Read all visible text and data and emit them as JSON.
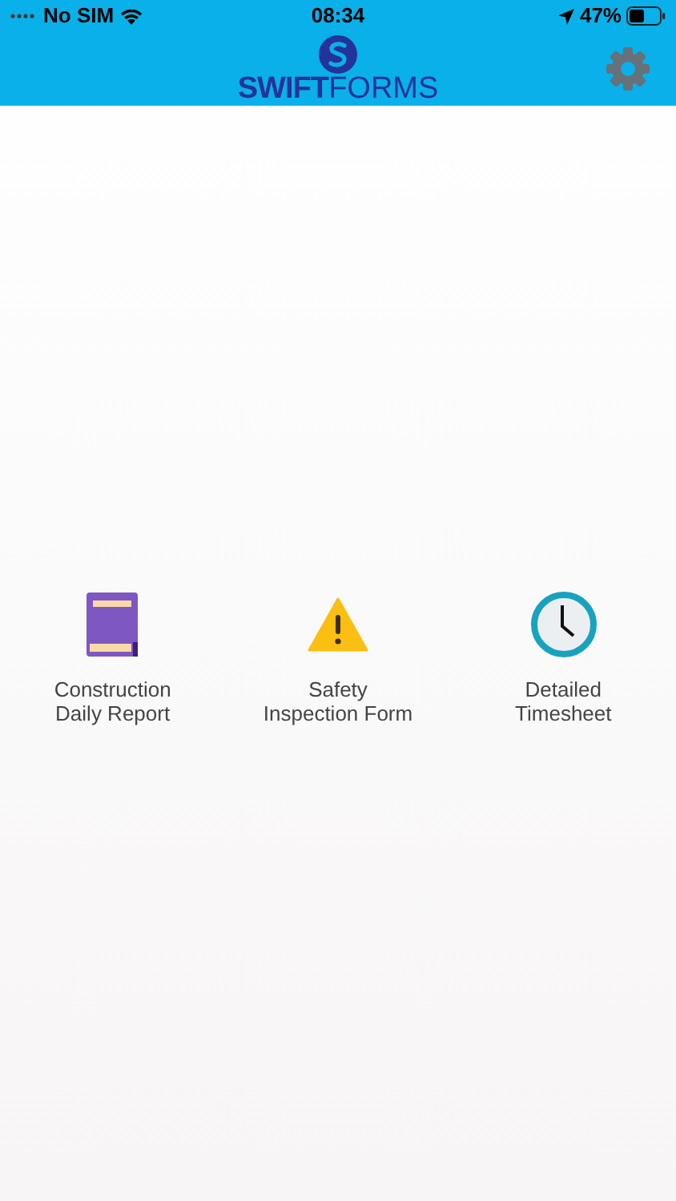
{
  "status_bar": {
    "carrier": "No SIM",
    "time": "08:34",
    "battery": "47%"
  },
  "header": {
    "logo_bold": "SWIFT",
    "logo_light": "FORMS"
  },
  "forms": [
    {
      "kind": "book",
      "label": "Construction\nDaily Report"
    },
    {
      "kind": "warning",
      "label": "Safety\nInspection Form"
    },
    {
      "kind": "clock",
      "label": "Detailed\nTimesheet"
    }
  ]
}
